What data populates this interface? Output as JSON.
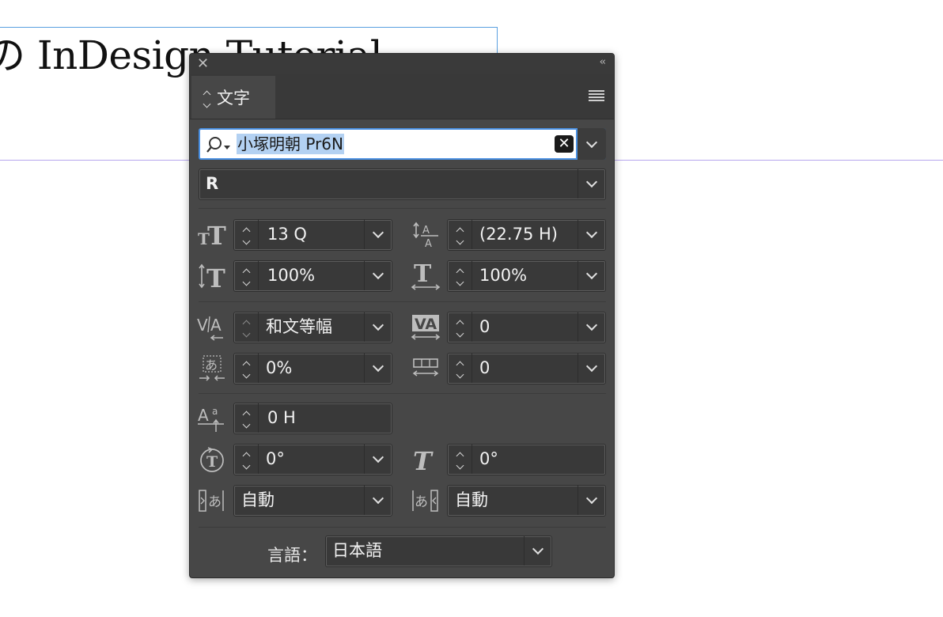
{
  "document": {
    "title": "の InDesign Tutorial"
  },
  "panel": {
    "tab_label": "文字",
    "font_family": {
      "value": "小塚明朝 Pr6N"
    },
    "font_style": {
      "value": "R"
    },
    "font_size": {
      "value": "13 Q"
    },
    "leading": {
      "value": "(22.75 H)"
    },
    "vertical_scale": {
      "value": "100%"
    },
    "horizontal_scale": {
      "value": "100%"
    },
    "kerning": {
      "value": "和文等幅"
    },
    "tracking": {
      "value": "0"
    },
    "tsume": {
      "value": "0%"
    },
    "aki": {
      "value": "0"
    },
    "baseline_shift": {
      "value": "0 H"
    },
    "character_rotation": {
      "value": "0°"
    },
    "skew": {
      "value": "0°"
    },
    "aki_before": {
      "value": "自動"
    },
    "aki_after": {
      "value": "自動"
    },
    "language": {
      "label": "言語：",
      "value": "日本語"
    }
  },
  "colors": {
    "panel_bg": "#474747",
    "field_bg": "#393939",
    "accent": "#4a90e2",
    "selection": "#b3d1f2",
    "guide": "#b6a6ee"
  }
}
